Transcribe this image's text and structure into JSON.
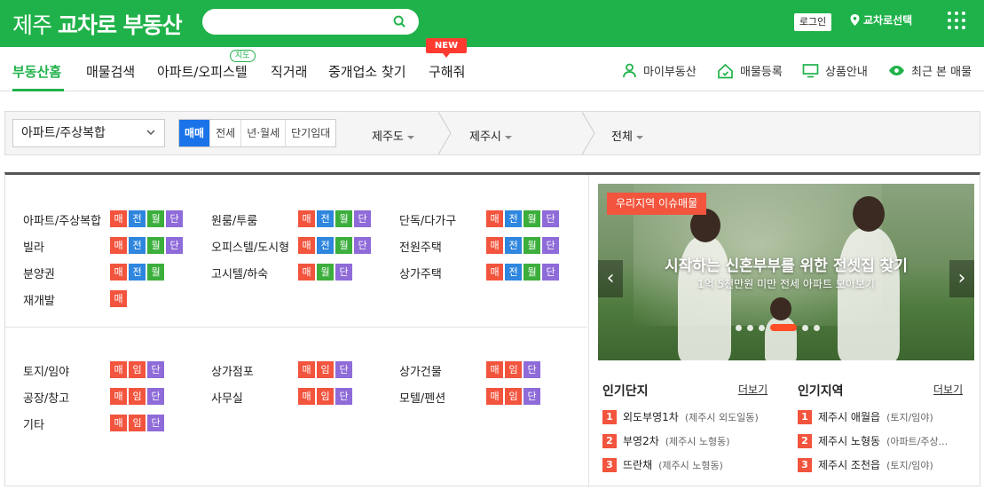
{
  "header": {
    "logo_region": "제주",
    "logo_brand": "교차로 부동산",
    "search_placeholder": "",
    "login": "로그인",
    "region_select": "교차로선택"
  },
  "nav": {
    "items": [
      "부동산홈",
      "매물검색",
      "아파트/오피스텔",
      "직거래",
      "중개업소 찾기",
      "구해줘"
    ],
    "tag_map": "지도",
    "tag_new": "NEW",
    "util": [
      "마이부동산",
      "매물등록",
      "상품안내",
      "최근 본 매물"
    ]
  },
  "filter": {
    "type_select": "아파트/주상복합",
    "deal_types": [
      "매매",
      "전세",
      "년·월세",
      "단기임대"
    ],
    "deal_selected": "매매",
    "locations": [
      "제주도",
      "제주시",
      "전체"
    ]
  },
  "categories_top": [
    {
      "name": "아파트/주상복합",
      "badges": [
        "매",
        "전",
        "월",
        "단"
      ]
    },
    {
      "name": "원룸/투룸",
      "badges": [
        "매",
        "전",
        "월",
        "단"
      ]
    },
    {
      "name": "단독/다가구",
      "badges": [
        "매",
        "전",
        "월",
        "단"
      ]
    },
    {
      "name": "빌라",
      "badges": [
        "매",
        "전",
        "월",
        "단"
      ]
    },
    {
      "name": "오피스텔/도시형",
      "badges": [
        "매",
        "전",
        "월",
        "단"
      ]
    },
    {
      "name": "전원주택",
      "badges": [
        "매",
        "전",
        "월",
        "단"
      ]
    },
    {
      "name": "분양권",
      "badges": [
        "매",
        "전",
        "월"
      ]
    },
    {
      "name": "고시텔/하숙",
      "badges": [
        "매",
        "월",
        "단"
      ]
    },
    {
      "name": "상가주택",
      "badges": [
        "매",
        "전",
        "월",
        "단"
      ]
    },
    {
      "name": "재개발",
      "badges": [
        "매"
      ]
    }
  ],
  "categories_bottom": [
    {
      "name": "토지/임야",
      "badges": [
        "매",
        "임",
        "단"
      ]
    },
    {
      "name": "상가점포",
      "badges": [
        "매",
        "임",
        "단"
      ]
    },
    {
      "name": "상가건물",
      "badges": [
        "매",
        "임",
        "단"
      ]
    },
    {
      "name": "공장/창고",
      "badges": [
        "매",
        "임",
        "단"
      ]
    },
    {
      "name": "사무실",
      "badges": [
        "매",
        "임",
        "단"
      ]
    },
    {
      "name": "모텔/펜션",
      "badges": [
        "매",
        "임",
        "단"
      ]
    },
    {
      "name": "기타",
      "badges": [
        "매",
        "임",
        "단"
      ]
    }
  ],
  "banner": {
    "label": "우리지역 이슈매물",
    "title": "시작하는 신혼부부를 위한 전셋집 찾기",
    "subtitle": "1억 5천만원 미만 전세 아파트 모아보기",
    "prev": "‹",
    "next": "›"
  },
  "popular_complex": {
    "title": "인기단지",
    "more": "더보기",
    "items": [
      {
        "rank": "1",
        "name": "외도부영1차",
        "sub": "(제주시 외도일동)"
      },
      {
        "rank": "2",
        "name": "부영2차",
        "sub": "(제주시 노형동)"
      },
      {
        "rank": "3",
        "name": "뜨란채",
        "sub": "(제주시 노형동)"
      }
    ]
  },
  "popular_region": {
    "title": "인기지역",
    "more": "더보기",
    "items": [
      {
        "rank": "1",
        "name": "제주시 애월읍",
        "sub": "(토지/임야)"
      },
      {
        "rank": "2",
        "name": "제주시 노형동",
        "sub": "(아파트/주상..."
      },
      {
        "rank": "3",
        "name": "제주시 조천읍",
        "sub": "(토지/임야)"
      }
    ]
  },
  "colors": {
    "brand": "#20b24a",
    "accent": "#f2543d",
    "selected": "#1a73e8"
  }
}
